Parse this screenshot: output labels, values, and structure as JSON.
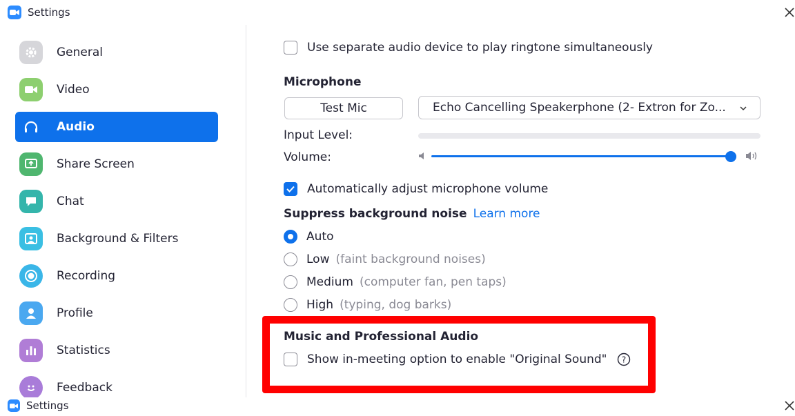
{
  "window": {
    "title": "Settings",
    "bottom_title": "Settings"
  },
  "colors": {
    "accent": "#0E71EB",
    "highlight": "#FF0000"
  },
  "sidebar": {
    "items": [
      {
        "label": "General",
        "icon": "gear-icon",
        "color": "#CFCFD4"
      },
      {
        "label": "Video",
        "icon": "video-camera-icon",
        "color": "#8DCF6F"
      },
      {
        "label": "Audio",
        "icon": "headphones-icon",
        "color": "#0E71EB",
        "active": true
      },
      {
        "label": "Share Screen",
        "icon": "share-screen-icon",
        "color": "#4FB66F"
      },
      {
        "label": "Chat",
        "icon": "chat-bubble-icon",
        "color": "#34B5AB"
      },
      {
        "label": "Background & Filters",
        "icon": "background-icon",
        "color": "#3ABFE3"
      },
      {
        "label": "Recording",
        "icon": "recording-icon",
        "color": "#3AB6E8"
      },
      {
        "label": "Profile",
        "icon": "profile-icon",
        "color": "#4AA8F0"
      },
      {
        "label": "Statistics",
        "icon": "statistics-icon",
        "color": "#B07DD6"
      },
      {
        "label": "Feedback",
        "icon": "feedback-icon",
        "color": "#A97CD9"
      }
    ]
  },
  "audio": {
    "ringtone_label": "Use separate audio device to play ringtone simultaneously",
    "microphone_title": "Microphone",
    "test_mic_label": "Test Mic",
    "microphone_device": "Echo Cancelling Speakerphone (2- Extron for Zo...",
    "input_level_label": "Input Level:",
    "input_level": 0,
    "volume_label": "Volume:",
    "volume": 1.0,
    "auto_adjust_label": "Automatically adjust microphone volume",
    "suppress_title": "Suppress background noise",
    "learn_more": "Learn more",
    "noise_options": [
      {
        "label": "Auto",
        "hint": "",
        "selected": true
      },
      {
        "label": "Low",
        "hint": "(faint background noises)"
      },
      {
        "label": "Medium",
        "hint": "(computer fan, pen taps)"
      },
      {
        "label": "High",
        "hint": "(typing, dog barks)"
      }
    ],
    "music_title": "Music and Professional Audio",
    "original_sound_label": "Show in-meeting option to enable \"Original Sound\""
  }
}
